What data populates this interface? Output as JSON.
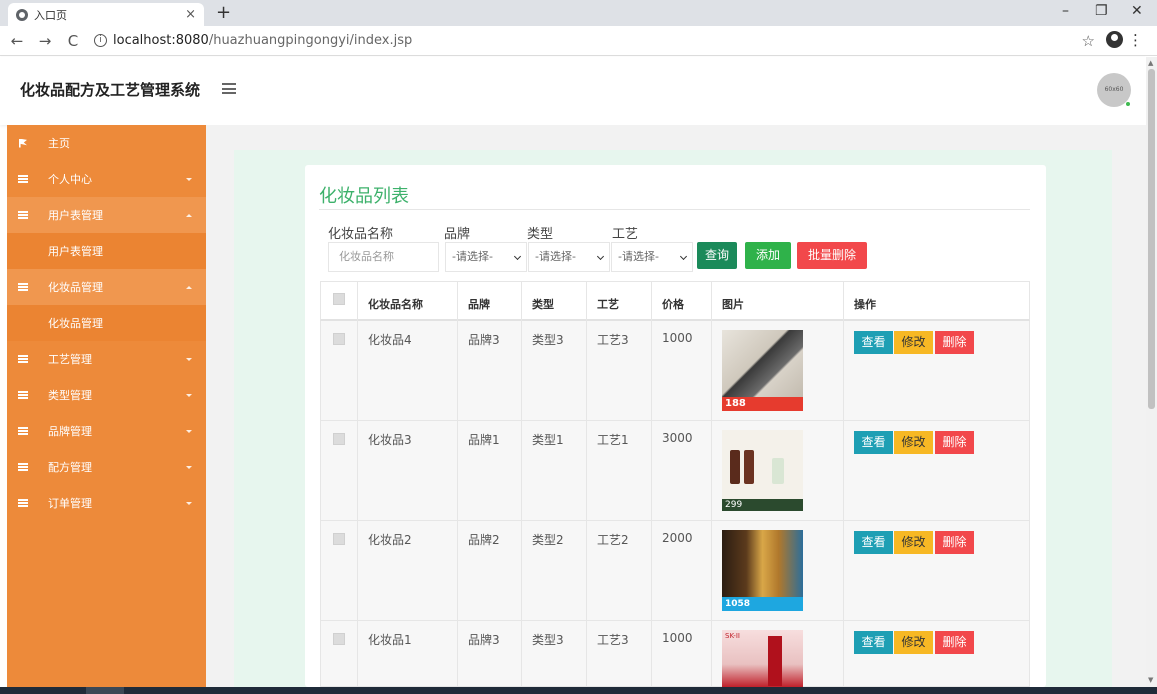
{
  "browser": {
    "tab_title": "入口页",
    "tab_close": "×",
    "new_tab": "+",
    "url_host": "localhost:8080",
    "url_path": "/huazhuangpingongyi/index.jsp",
    "nav_back": "←",
    "nav_forward": "→",
    "nav_reload": "C",
    "info": "i",
    "star": "☆",
    "menu": "⋮",
    "win_min": "–",
    "win_max": "❐",
    "win_close": "✕"
  },
  "header": {
    "brand": "化妆品配方及工艺管理系统",
    "avatar_text": "60x60"
  },
  "sidebar": {
    "items": [
      {
        "label": "主页",
        "icon": "flag-icon"
      },
      {
        "label": "个人中心",
        "icon": "grid-icon"
      },
      {
        "label": "用户表管理",
        "icon": "grid-icon"
      },
      {
        "label": "化妆品管理",
        "icon": "grid-icon"
      },
      {
        "label": "工艺管理",
        "icon": "grid-icon"
      },
      {
        "label": "类型管理",
        "icon": "grid-icon"
      },
      {
        "label": "品牌管理",
        "icon": "grid-icon"
      },
      {
        "label": "配方管理",
        "icon": "grid-icon"
      },
      {
        "label": "订单管理",
        "icon": "grid-icon"
      }
    ],
    "submenus": [
      "用户表管理",
      "化妆品管理"
    ]
  },
  "main": {
    "title": "化妆品列表",
    "filters": {
      "name_label": "化妆品名称",
      "name_placeholder": "化妆品名称",
      "brand_label": "品牌",
      "type_label": "类型",
      "craft_label": "工艺",
      "select_placeholder": "-请选择-"
    },
    "buttons": {
      "search": "查询",
      "add": "添加",
      "batch_delete": "批量删除"
    },
    "table": {
      "headers": [
        "化妆品名称",
        "品牌",
        "类型",
        "工艺",
        "价格",
        "图片",
        "操作"
      ],
      "rows": [
        {
          "name": "化妆品4",
          "brand": "品牌3",
          "type": "类型3",
          "craft": "工艺3",
          "price": "1000",
          "promo": "188"
        },
        {
          "name": "化妆品3",
          "brand": "品牌1",
          "type": "类型1",
          "craft": "工艺1",
          "price": "3000",
          "promo": "299"
        },
        {
          "name": "化妆品2",
          "brand": "品牌2",
          "type": "类型2",
          "craft": "工艺2",
          "price": "2000",
          "promo": "1058"
        },
        {
          "name": "化妆品1",
          "brand": "品牌3",
          "type": "类型3",
          "craft": "工艺3",
          "price": "1000",
          "promo": "SK-II"
        }
      ],
      "actions": {
        "view": "查看",
        "edit": "修改",
        "delete": "删除"
      }
    }
  },
  "colors": {
    "sidebar": "#ed8a3a",
    "title_green": "#3db16b",
    "search_btn": "#1b8a5a",
    "add_btn": "#2fb24a",
    "delete_btn": "#f2484b",
    "view_btn": "#1e9fb4",
    "edit_btn": "#f7b824"
  }
}
